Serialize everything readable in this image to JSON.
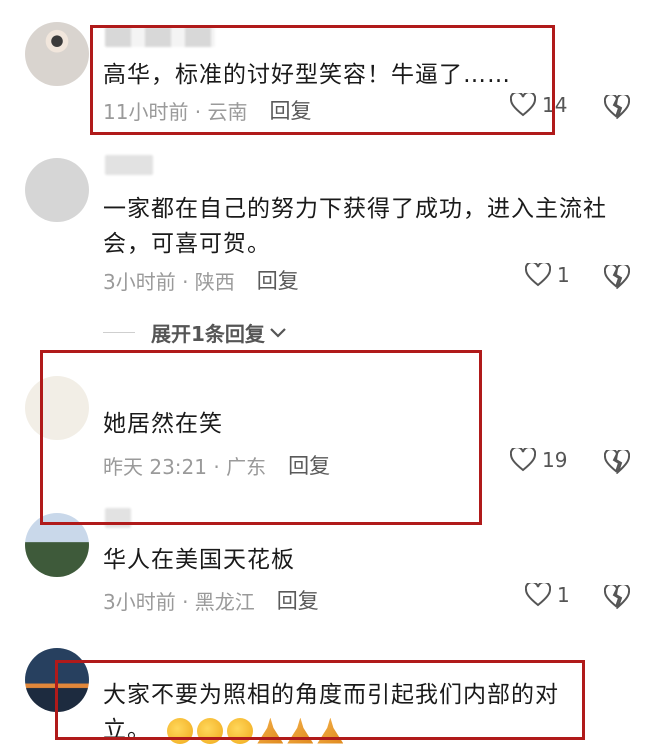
{
  "comments": [
    {
      "text": "高华，标准的讨好型笑容！牛逼了……",
      "time_location": "11小时前 · 云南",
      "reply_label": "回复",
      "likes": "14"
    },
    {
      "text": "一家都在自己的努力下获得了成功，进入主流社会，可喜可贺。",
      "time_location": "3小时前 · 陕西",
      "reply_label": "回复",
      "likes": "1"
    },
    {
      "text": "她居然在笑",
      "time_location": "昨天 23:21 · 广东",
      "reply_label": "回复",
      "likes": "19"
    },
    {
      "text": "华人在美国天花板",
      "time_location": "3小时前 · 黑龙江",
      "reply_label": "回复",
      "likes": "1"
    },
    {
      "text": "大家不要为照相的角度而引起我们内部的对立。",
      "emoji": [
        "smirk",
        "smirk",
        "smirk",
        "pray",
        "pray",
        "pray"
      ]
    }
  ],
  "expand_label": "展开1条回复",
  "colors": {
    "highlight_box": "#b01a1a",
    "meta_text": "#9a9a9a"
  }
}
